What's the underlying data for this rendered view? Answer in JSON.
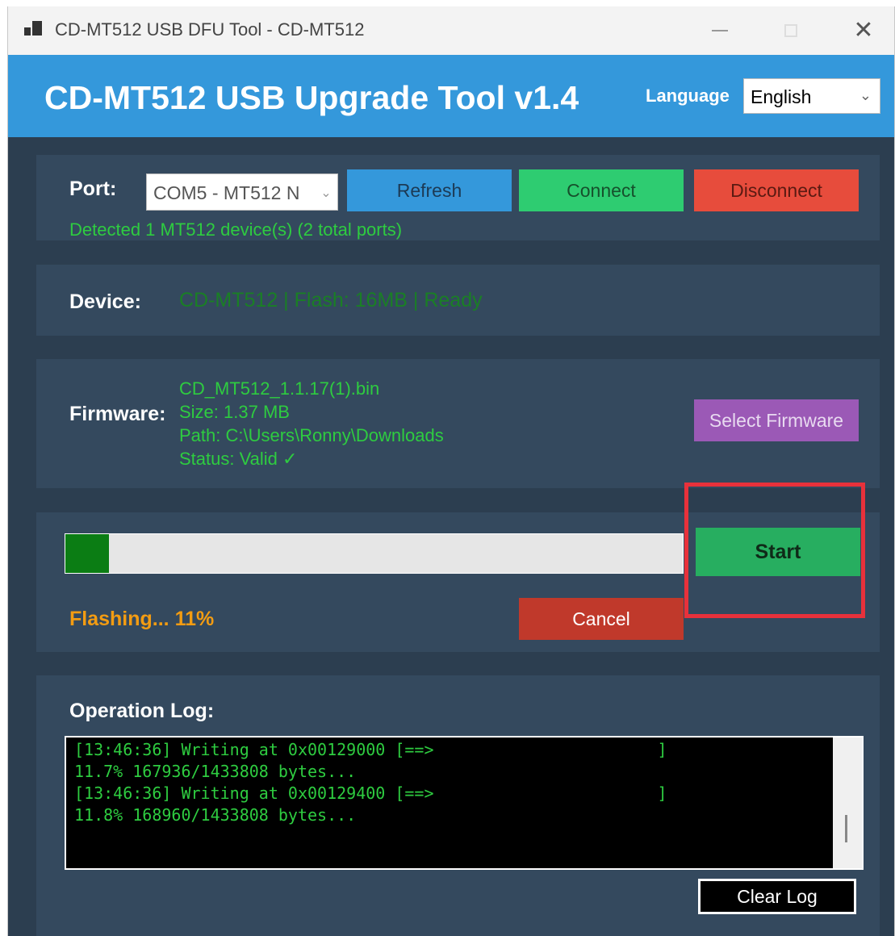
{
  "window": {
    "title": "CD-MT512 USB DFU Tool - CD-MT512",
    "controls": {
      "minimize": "minimize",
      "maximize": "maximize",
      "close": "close"
    }
  },
  "header": {
    "title": "CD-MT512 USB Upgrade Tool v1.4",
    "language_label": "Language",
    "language_value": "English",
    "language_options": [
      "English"
    ]
  },
  "port": {
    "label": "Port:",
    "selected": "COM5 - MT512 N",
    "refresh_label": "Refresh",
    "connect_label": "Connect",
    "disconnect_label": "Disconnect",
    "detected_text": "Detected 1 MT512 device(s) (2 total ports)"
  },
  "device": {
    "label": "Device:",
    "info": "CD-MT512 | Flash: 16MB | Ready"
  },
  "firmware": {
    "label": "Firmware:",
    "filename": "CD_MT512_1.1.17(1).bin",
    "size": "Size: 1.37 MB",
    "path": "Path: C:\\Users\\Ronny\\Downloads",
    "status": "Status: Valid ✓",
    "select_label": "Select Firmware"
  },
  "flash": {
    "progress_fraction": 0.07,
    "status_text": "Flashing... 11%",
    "start_label": "Start",
    "cancel_label": "Cancel"
  },
  "log": {
    "label": "Operation Log:",
    "text": "[13:46:36] Writing at 0x00129000 [==>                       ]\n11.7% 167936/1433808 bytes...\n[13:46:36] Writing at 0x00129400 [==>                       ]\n11.8% 168960/1433808 bytes...",
    "clear_label": "Clear Log"
  },
  "colors": {
    "header": "#3498db",
    "body": "#2c3e50",
    "panel": "#34495e",
    "refresh": "#3498db",
    "connect": "#2ecc71",
    "disconnect": "#e74c3c",
    "select_firmware": "#9b59b6",
    "start": "#27ae60",
    "cancel": "#c0392b",
    "status_green": "#2ecc40",
    "flashing_orange": "#f39c12",
    "highlight_red": "#e8313b"
  }
}
